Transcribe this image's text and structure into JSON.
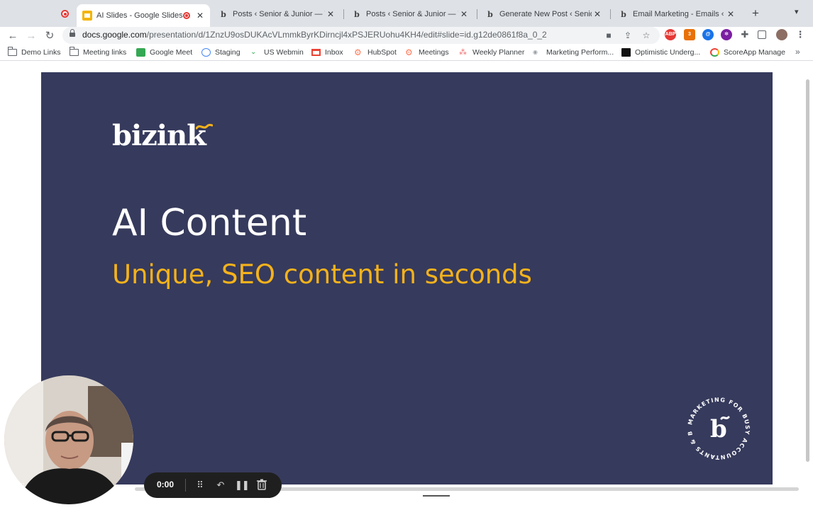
{
  "browser": {
    "tabs": [
      {
        "title": "AI Slides - Google Slides",
        "active": true,
        "recording": true
      },
      {
        "title": "Posts ‹ Senior & Junior — Wo"
      },
      {
        "title": "Posts ‹ Senior & Junior — Wo"
      },
      {
        "title": "Generate New Post ‹ Senior I"
      },
      {
        "title": "Email Marketing - Emails ‹ Se"
      }
    ],
    "url_host": "docs.google.com",
    "url_path": "/presentation/d/1ZnzU9osDUKAcVLmmkByrKDirncjl4xPSJERUohu4KH4/edit#slide=id.g12de0861f8a_0_2",
    "bookmarks": [
      {
        "label": "Demo Links",
        "icon": "folder-icon"
      },
      {
        "label": "Meeting links",
        "icon": "folder-icon"
      },
      {
        "label": "Google Meet",
        "icon": "meet-icon"
      },
      {
        "label": "Staging",
        "icon": "staging-icon"
      },
      {
        "label": "US Webmin",
        "icon": "webmin-icon"
      },
      {
        "label": "Inbox",
        "icon": "gmail-icon"
      },
      {
        "label": "HubSpot",
        "icon": "hubspot-icon"
      },
      {
        "label": "Meetings",
        "icon": "hubspot-icon"
      },
      {
        "label": "Weekly Planner",
        "icon": "asana-icon"
      },
      {
        "label": "Marketing Perform...",
        "icon": "dot-icon"
      },
      {
        "label": "Optimistic Underg...",
        "icon": "book-icon"
      },
      {
        "label": "ScoreApp Manage",
        "icon": "scoreapp-icon"
      }
    ]
  },
  "slide": {
    "logo_text": "bizink",
    "title": "AI Content",
    "subtitle": "Unique, SEO content in seconds",
    "seal_text": "MARKETING FOR BUSY ACCOUNTANTS & BOOKKEEPERS",
    "seal_letter": "b",
    "colors": {
      "background": "#363a5c",
      "accent": "#f5b21b",
      "title": "#ffffff"
    }
  },
  "recorder": {
    "time": "0:00"
  }
}
